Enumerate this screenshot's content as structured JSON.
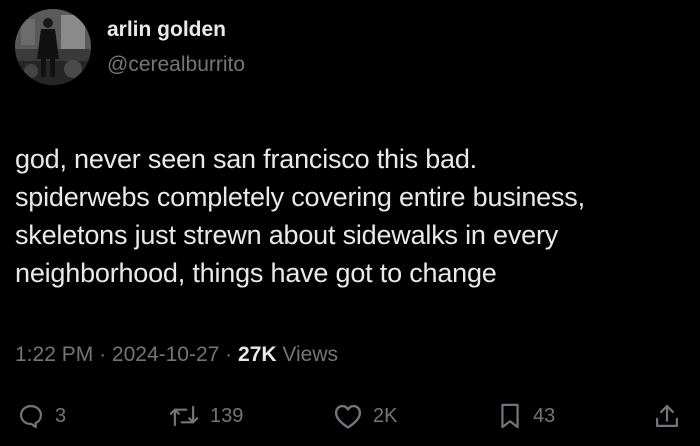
{
  "author": {
    "display_name": "arlin golden",
    "handle": "@cerealburrito"
  },
  "tweet": {
    "text_lines": [
      "god, never seen san francisco this bad.",
      "spiderwebs completely covering entire business,",
      "skeletons just strewn about sidewalks in every",
      "neighborhood, things have got to change"
    ],
    "time": "1:22 PM",
    "separator": "·",
    "date": "2024-10-27",
    "views_count": "27K",
    "views_label": "Views"
  },
  "actions": {
    "replies": "3",
    "reposts": "139",
    "likes": "2K",
    "bookmarks": "43"
  },
  "icons": {
    "reply": "reply-icon",
    "repost": "repost-icon",
    "like": "heart-icon",
    "bookmark": "bookmark-icon",
    "share": "share-icon"
  },
  "colors": {
    "background": "#000000",
    "primary_text": "#e7e9ea",
    "secondary_text": "#71767b"
  }
}
